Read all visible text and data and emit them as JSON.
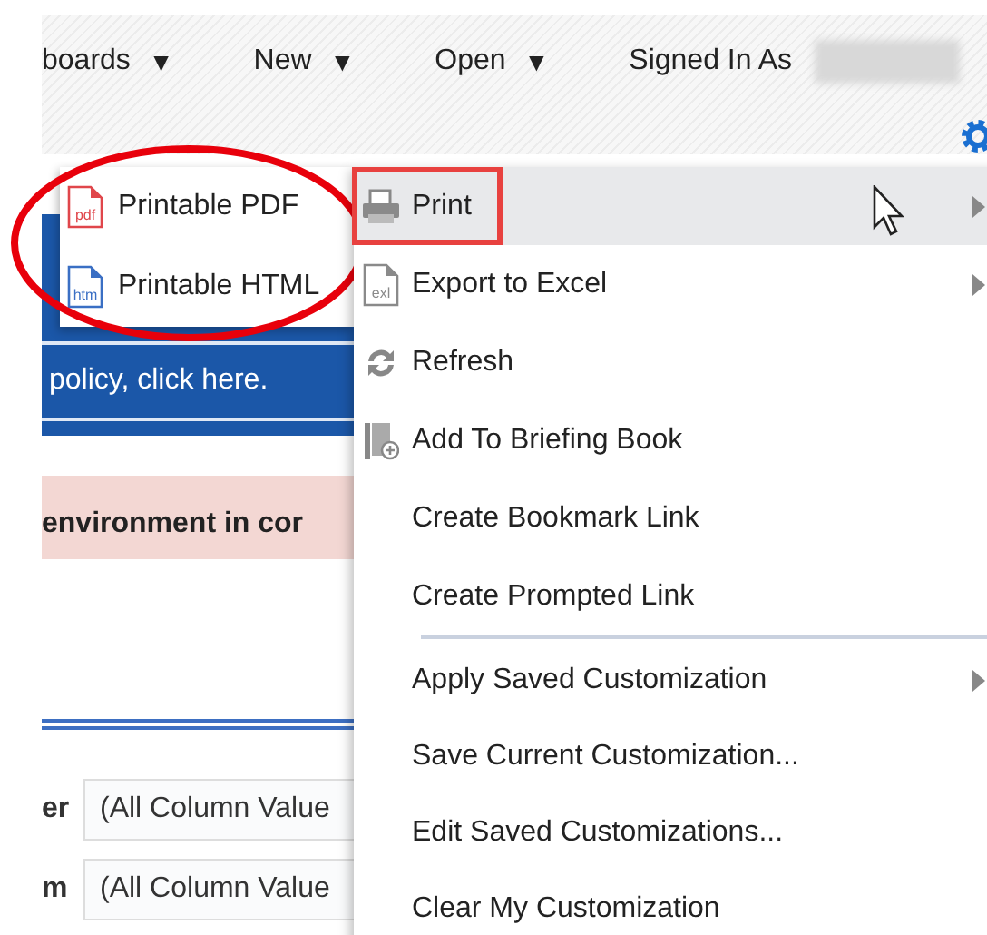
{
  "header": {
    "nav": [
      {
        "label": "boards",
        "caret": "▼"
      },
      {
        "label": "New",
        "caret": "▼"
      },
      {
        "label": "Open",
        "caret": "▼"
      }
    ],
    "signed_in_label": "Signed In As"
  },
  "page": {
    "banner_link": "policy, click here.",
    "notice": "environment in cor",
    "fields": [
      {
        "label": "er",
        "value": "(All Column Value"
      },
      {
        "label": "m",
        "value": "(All Column Value"
      }
    ]
  },
  "submenu": {
    "annotated": true,
    "items": [
      {
        "label": "Printable PDF",
        "kind": "document",
        "icon_text": "pdf",
        "color": "#e0464b"
      },
      {
        "label": "Printable HTML",
        "kind": "document",
        "icon_text": "htm",
        "color": "#3a6fc4"
      }
    ]
  },
  "menu": {
    "items": [
      {
        "kind": "printer",
        "label": "Print",
        "submenu": true,
        "selected": true,
        "annotated": true
      },
      {
        "kind": "document",
        "label": "Export to Excel",
        "icon_text": "exl",
        "submenu": true,
        "selected": false,
        "annotated": false
      },
      {
        "kind": "refresh",
        "label": "Refresh",
        "submenu": false,
        "selected": false,
        "annotated": false
      },
      {
        "kind": "book",
        "label": "Add To Briefing Book",
        "submenu": false,
        "selected": false,
        "annotated": false
      },
      {
        "kind": "plain",
        "label": "Create Bookmark Link",
        "submenu": false,
        "selected": false,
        "annotated": false
      },
      {
        "kind": "plain",
        "label": "Create Prompted Link",
        "submenu": false,
        "selected": false,
        "annotated": false
      },
      {
        "kind": "separator"
      },
      {
        "kind": "plain",
        "label": "Apply Saved Customization",
        "submenu": true,
        "selected": false,
        "annotated": false
      },
      {
        "kind": "plain",
        "label": "Save Current Customization...",
        "submenu": false,
        "selected": false,
        "annotated": false
      },
      {
        "kind": "plain",
        "label": "Edit Saved Customizations...",
        "submenu": false,
        "selected": false,
        "annotated": false
      },
      {
        "kind": "plain",
        "label": "Clear My Customization",
        "submenu": false,
        "selected": false,
        "annotated": false
      }
    ]
  }
}
